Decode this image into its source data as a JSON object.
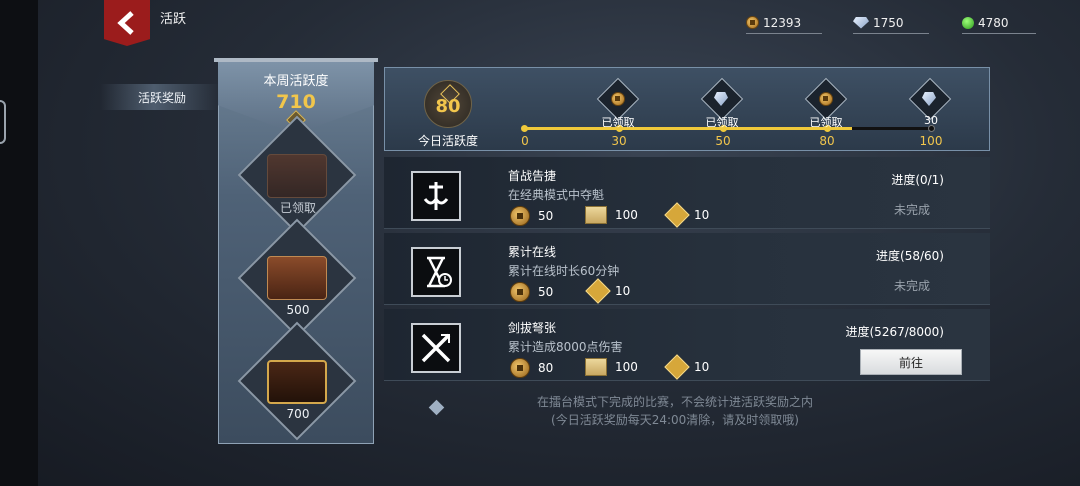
{
  "header": {
    "title": "活跃"
  },
  "currencies": [
    {
      "icon": "copper-coin-icon",
      "value": "12393"
    },
    {
      "icon": "silver-ingot-icon",
      "value": "1750"
    },
    {
      "icon": "jade-icon",
      "value": "4780"
    }
  ],
  "sidebar": {
    "active_tab": "活跃奖励"
  },
  "weekly": {
    "label": "本周活跃度",
    "value": "710",
    "chests": [
      {
        "label": "已领取",
        "state": "claimed"
      },
      {
        "label": "500",
        "state": "locked"
      },
      {
        "label": "700",
        "state": "locked"
      }
    ]
  },
  "today": {
    "value": "80",
    "label": "今日活跃度",
    "progress_fraction": 0.8,
    "ticks": [
      "0",
      "30",
      "50",
      "80",
      "100"
    ],
    "milestones": [
      {
        "threshold": "30",
        "icon": "coin-reward-icon",
        "status": "已领取"
      },
      {
        "threshold": "50",
        "icon": "ingot-reward-icon",
        "status": "已领取"
      },
      {
        "threshold": "80",
        "icon": "coin-reward-icon",
        "status": "已领取"
      },
      {
        "threshold": "100",
        "icon": "ingot-reward-icon",
        "status": "30"
      }
    ]
  },
  "tasks": [
    {
      "name": "首战告捷",
      "desc": "在经典模式中夺魁",
      "icon": "victory-icon",
      "rewards": [
        {
          "icon": "coin-icon",
          "amount": "50"
        },
        {
          "icon": "scroll-icon",
          "amount": "100"
        },
        {
          "icon": "activity-badge-icon",
          "amount": "10"
        }
      ],
      "progress": "进度(0/1)",
      "status": "未完成"
    },
    {
      "name": "累计在线",
      "desc": "累计在线时长60分钟",
      "icon": "hourglass-icon",
      "rewards": [
        {
          "icon": "coin-icon",
          "amount": "50"
        },
        {
          "icon": "activity-badge-icon",
          "amount": "10"
        }
      ],
      "progress": "进度(58/60)",
      "status": "未完成"
    },
    {
      "name": "剑拔弩张",
      "desc": "累计造成8000点伤害",
      "icon": "crossed-weapons-icon",
      "rewards": [
        {
          "icon": "coin-icon",
          "amount": "80"
        },
        {
          "icon": "scroll-icon",
          "amount": "100"
        },
        {
          "icon": "activity-badge-icon",
          "amount": "10"
        }
      ],
      "progress": "进度(5267/8000)",
      "button": "前往"
    }
  ],
  "footer": {
    "line1": "在擂台模式下完成的比赛，不会统计进活跃奖励之内",
    "line2": "(今日活跃奖励每天24:00清除，请及时领取哦)"
  }
}
